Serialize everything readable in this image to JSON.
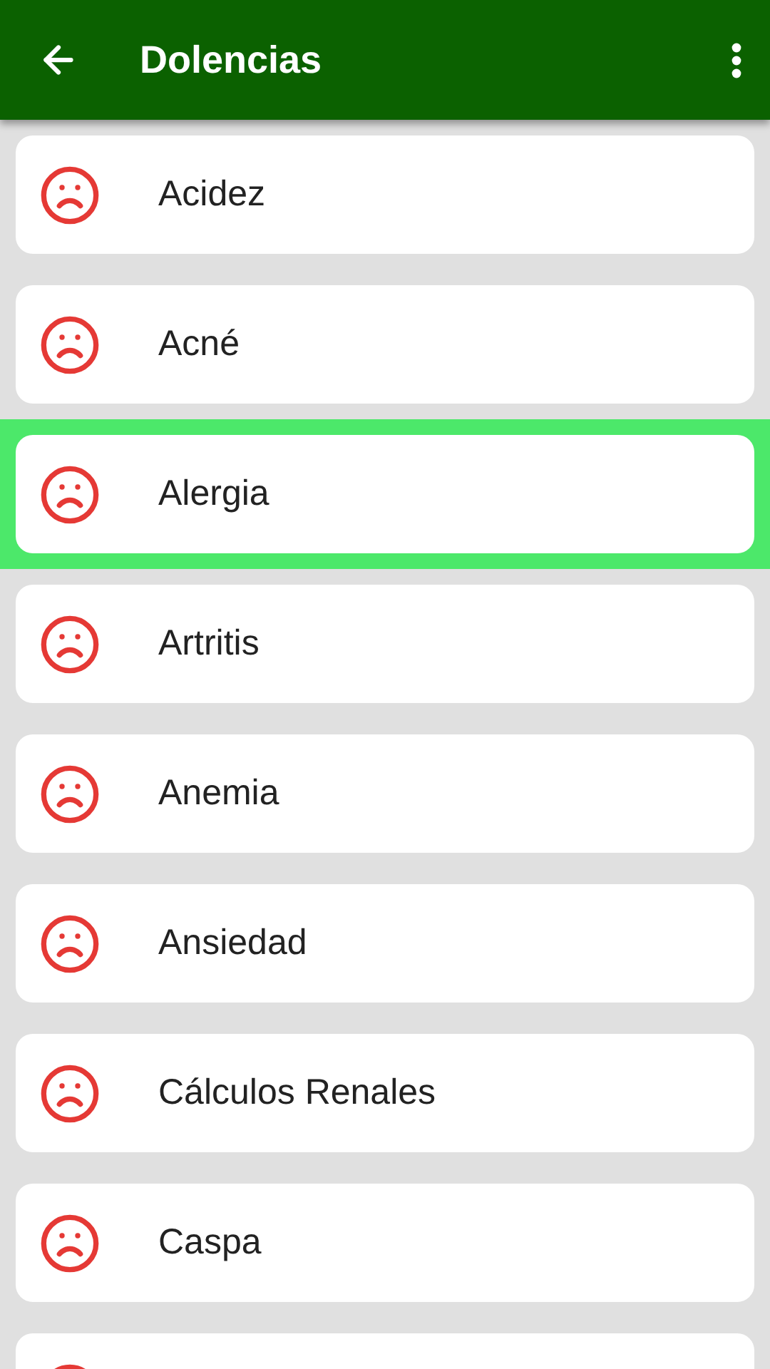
{
  "app_bar": {
    "title": "Dolencias"
  },
  "items": [
    {
      "label": "Acidez",
      "selected": false
    },
    {
      "label": "Acné",
      "selected": false
    },
    {
      "label": "Alergia",
      "selected": true
    },
    {
      "label": "Artritis",
      "selected": false
    },
    {
      "label": "Anemia",
      "selected": false
    },
    {
      "label": "Ansiedad",
      "selected": false
    },
    {
      "label": "Cálculos Renales",
      "selected": false
    },
    {
      "label": "Caspa",
      "selected": false
    }
  ]
}
